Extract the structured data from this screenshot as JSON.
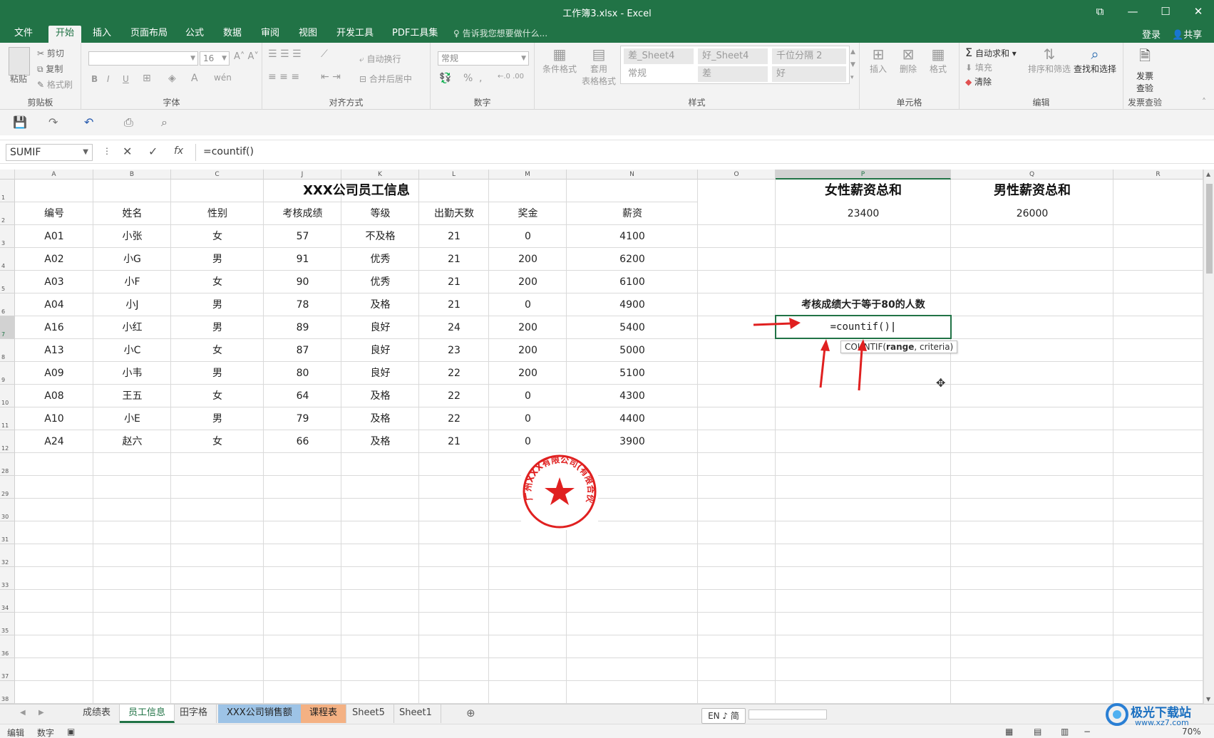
{
  "window": {
    "title": "工作簿3.xlsx - Excel",
    "buttons": [
      "⧉",
      "—",
      "☐",
      "✕"
    ]
  },
  "menu": {
    "tabs": [
      "文件",
      "开始",
      "插入",
      "页面布局",
      "公式",
      "数据",
      "审阅",
      "视图",
      "开发工具",
      "PDF工具集"
    ],
    "active_tab": "开始",
    "tell_me": "告诉我您想要做什么...",
    "login": "登录",
    "share": "共享"
  },
  "ribbon": {
    "clipboard": {
      "paste": "粘贴",
      "cut": "剪切",
      "copy": "复制",
      "format_painter": "格式刷",
      "label": "剪贴板"
    },
    "font": {
      "font_name": "",
      "font_size": "16",
      "bold": "B",
      "italic": "I",
      "underline": "U",
      "label": "字体"
    },
    "alignment": {
      "wrap": "自动换行",
      "merge": "合并后居中",
      "label": "对齐方式"
    },
    "number": {
      "format": "常规",
      "percent": "%",
      "comma": ",",
      "label": "数字"
    },
    "styles": {
      "conditional": "条件格式",
      "table": "套用\n表格格式",
      "cells": [
        "差_Sheet4",
        "好_Sheet4",
        "千位分隔 2",
        "常规",
        "差",
        "好"
      ],
      "label": "样式"
    },
    "cells_group": {
      "insert": "插入",
      "delete": "删除",
      "format": "格式",
      "label": "单元格"
    },
    "editing": {
      "autosum": "自动求和",
      "fill": "填充",
      "clear": "清除",
      "sort": "排序和筛选",
      "find": "查找和选择",
      "label": "编辑"
    },
    "invoice": {
      "check": "发票\n查验",
      "label": "发票查验"
    }
  },
  "formula_bar": {
    "name_box": "SUMIF",
    "cancel": "✕",
    "enter": "✓",
    "fx": "fx",
    "formula": "=countif()"
  },
  "columns": [
    "A",
    "B",
    "C",
    "J",
    "K",
    "L",
    "M",
    "N",
    "O",
    "P",
    "Q",
    "R"
  ],
  "rows": [
    "1",
    "2",
    "3",
    "4",
    "5",
    "6",
    "7",
    "8",
    "9",
    "10",
    "11",
    "12",
    "28",
    "29",
    "30",
    "31",
    "32",
    "33",
    "34",
    "35",
    "36",
    "37",
    "38"
  ],
  "sheet": {
    "title": "XXX公司员工信息",
    "headers": [
      "编号",
      "姓名",
      "性别",
      "考核成绩",
      "等级",
      "出勤天数",
      "奖金",
      "薪资"
    ],
    "records": [
      [
        "A01",
        "小张",
        "女",
        "57",
        "不及格",
        "21",
        "0",
        "4100"
      ],
      [
        "A02",
        "小G",
        "男",
        "91",
        "优秀",
        "21",
        "200",
        "6200"
      ],
      [
        "A03",
        "小F",
        "女",
        "90",
        "优秀",
        "21",
        "200",
        "6100"
      ],
      [
        "A04",
        "小J",
        "男",
        "78",
        "及格",
        "21",
        "0",
        "4900"
      ],
      [
        "A16",
        "小红",
        "男",
        "89",
        "良好",
        "24",
        "200",
        "5400"
      ],
      [
        "A13",
        "小C",
        "女",
        "87",
        "良好",
        "23",
        "200",
        "5000"
      ],
      [
        "A09",
        "小韦",
        "男",
        "80",
        "良好",
        "22",
        "200",
        "5100"
      ],
      [
        "A08",
        "王五",
        "女",
        "64",
        "及格",
        "22",
        "0",
        "4300"
      ],
      [
        "A10",
        "小E",
        "男",
        "79",
        "及格",
        "22",
        "0",
        "4400"
      ],
      [
        "A24",
        "赵六",
        "女",
        "66",
        "及格",
        "21",
        "0",
        "3900"
      ]
    ],
    "female_total_label": "女性薪资总和",
    "female_total_value": "23400",
    "male_total_label": "男性薪资总和",
    "male_total_value": "26000",
    "count_label": "考核成绩大于等于80的人数",
    "active_cell_text": "=countif()",
    "tooltip_fn": "COUNTIF(",
    "tooltip_arg1": "range",
    "tooltip_rest": ", criteria)"
  },
  "seal": {
    "text": "广州XXX有限公司(有限合伙)",
    "color": "#e02020"
  },
  "sheet_tabs": [
    {
      "label": "成绩表",
      "style": "normal"
    },
    {
      "label": "员工信息",
      "style": "active"
    },
    {
      "label": "田字格",
      "style": "normal"
    },
    {
      "label": "XXX公司销售额",
      "style": "blue"
    },
    {
      "label": "课程表",
      "style": "orange"
    },
    {
      "label": "Sheet5",
      "style": "normal"
    },
    {
      "label": "Sheet1",
      "style": "normal"
    }
  ],
  "add_sheet": "⊕",
  "status": {
    "mode": "编辑",
    "num": "数字",
    "zoom": "70%"
  },
  "ime": "EN ♪ 简",
  "watermark": {
    "brand": "极光下载站",
    "url": "www.xz7.com"
  },
  "colors": {
    "excel_green": "#217346",
    "arrow_red": "#e02020"
  }
}
